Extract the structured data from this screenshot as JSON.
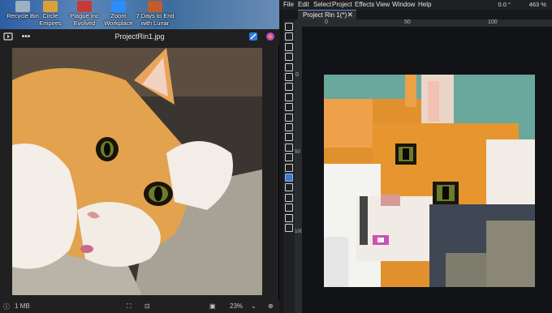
{
  "desktop": {
    "icons": [
      {
        "label": "Recycle Bin",
        "color": "#9fb0c0"
      },
      {
        "label": "Circle\nEmpires",
        "color": "#d9a13a"
      },
      {
        "label": "Plague Inc\nEvolved",
        "color": "#c83a3a"
      },
      {
        "label": "Zoom\nWorkplace",
        "color": "#2d8cff"
      },
      {
        "label": "7 Days to End\nwith Lunar",
        "color": "#c15c2c"
      }
    ]
  },
  "viewer": {
    "title": "ProjectRin1.jpg",
    "status_size": "1 MB",
    "zoom": "23%"
  },
  "editor": {
    "menu": [
      "File",
      "Edit",
      "Select",
      "Project",
      "Effects",
      "View",
      "Window",
      "Help"
    ],
    "rotation": "0.0 °",
    "zoom": "463 %",
    "tab_label": "Project Rin 1(*)",
    "ruler_top": [
      "0",
      "50",
      "100"
    ],
    "ruler_left": [
      "0",
      "50",
      "100"
    ]
  },
  "colors": {
    "accent": "#3d79d4",
    "teal": "#6aa79d",
    "orange": "#e0912e"
  }
}
